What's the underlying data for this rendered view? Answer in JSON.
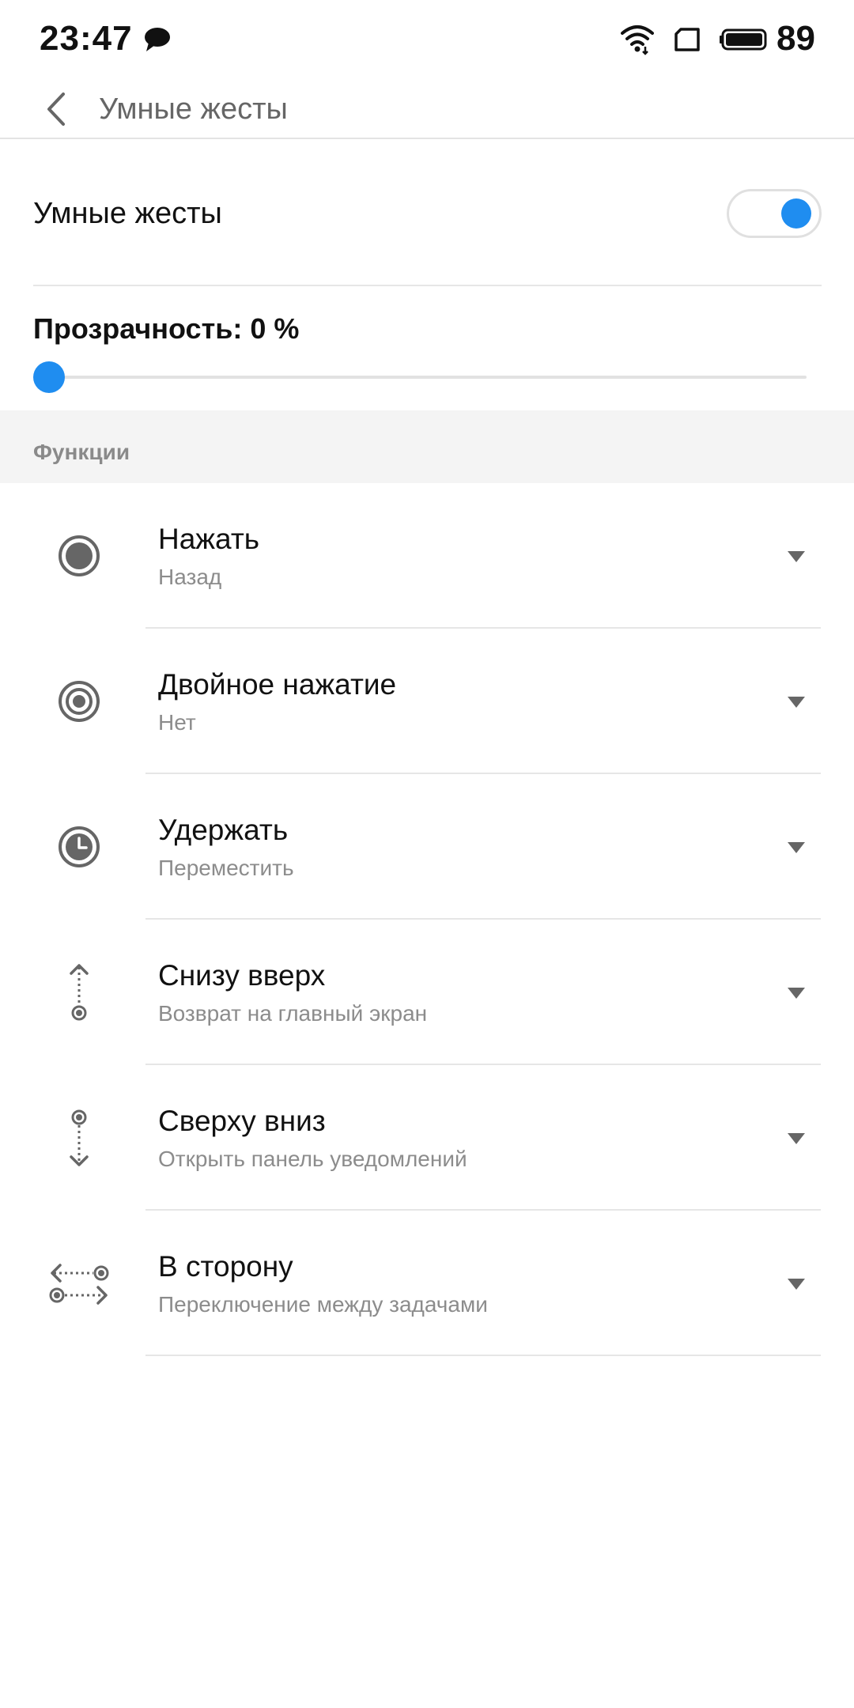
{
  "status_bar": {
    "time": "23:47",
    "battery": "89",
    "icons": [
      "chat-bubble-icon",
      "wifi-icon",
      "sim-card-icon",
      "battery-icon"
    ]
  },
  "header": {
    "back_icon": "chevron-left-icon",
    "title": "Умные жесты"
  },
  "toggle": {
    "label": "Умные жесты",
    "on": true
  },
  "transparency": {
    "label": "Прозрачность: 0 %",
    "value": 0
  },
  "section": {
    "title": "Функции"
  },
  "functions": [
    {
      "icon": "single-tap-icon",
      "title": "Нажать",
      "value": "Назад"
    },
    {
      "icon": "double-tap-icon",
      "title": "Двойное нажатие",
      "value": "Нет"
    },
    {
      "icon": "hold-clock-icon",
      "title": "Удержать",
      "value": "Переместить"
    },
    {
      "icon": "swipe-up-icon",
      "title": "Снизу вверх",
      "value": "Возврат на главный экран"
    },
    {
      "icon": "swipe-down-icon",
      "title": "Сверху вниз",
      "value": "Открыть панель уведомлений"
    },
    {
      "icon": "swipe-sideways-icon",
      "title": "В сторону",
      "value": "Переключение между задачами"
    }
  ],
  "colors": {
    "accent": "#1f8df0",
    "icon_gray": "#666666",
    "subtitle_gray": "#8c8c8c",
    "divider": "#e6e6e6",
    "section_bg": "#f4f4f4"
  }
}
